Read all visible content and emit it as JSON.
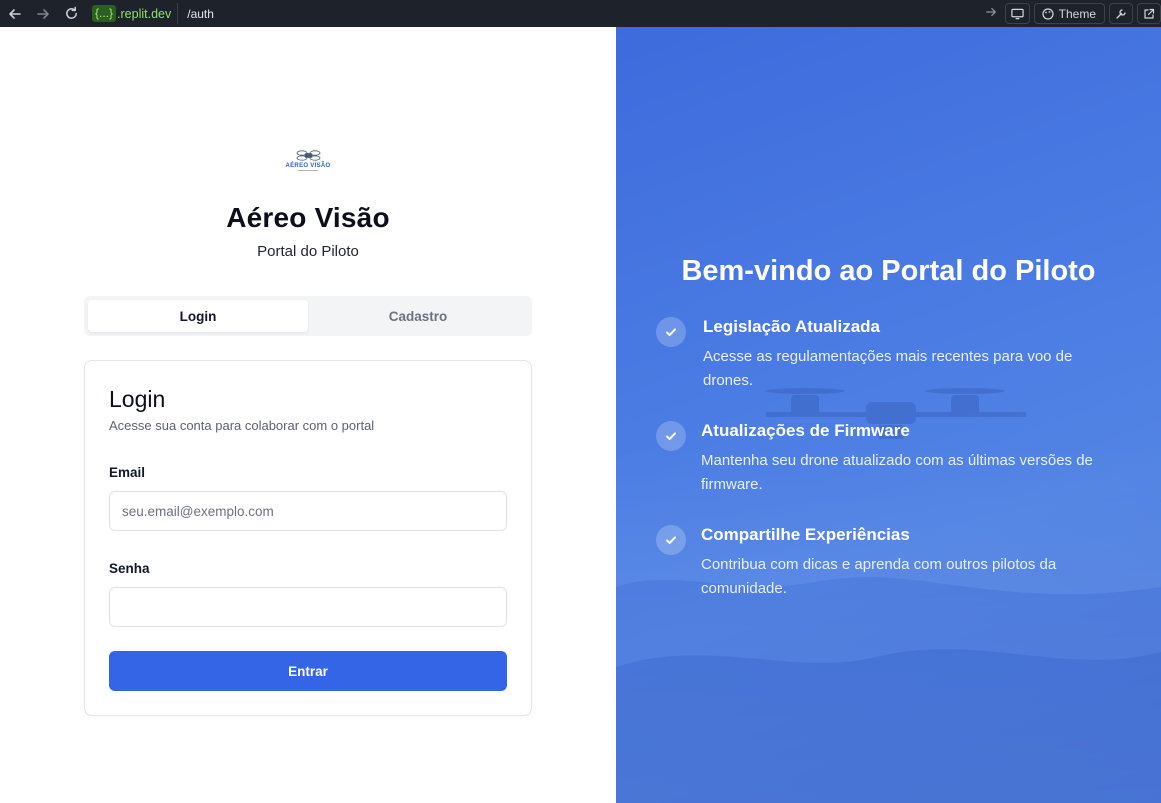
{
  "browser": {
    "url_chip": "{...}",
    "url_domain": ".replit.dev",
    "url_path": "/auth",
    "theme_label": "Theme"
  },
  "brand": {
    "logo_text": "AÉREO VISÃO",
    "title": "Aéreo Visão",
    "subtitle": "Portal do Piloto"
  },
  "tabs": [
    {
      "label": "Login",
      "active": true
    },
    {
      "label": "Cadastro",
      "active": false
    }
  ],
  "login_card": {
    "title": "Login",
    "description": "Acesse sua conta para colaborar com o portal",
    "email_label": "Email",
    "email_placeholder": "seu.email@exemplo.com",
    "email_value": "",
    "password_label": "Senha",
    "password_value": "",
    "submit_label": "Entrar"
  },
  "hero": {
    "title": "Bem-vindo ao Portal do Piloto",
    "features": [
      {
        "title": "Legislação Atualizada",
        "description": "Acesse as regulamentações mais recentes para voo de drones."
      },
      {
        "title": "Atualizações de Firmware",
        "description": "Mantenha seu drone atualizado com as últimas versões de firmware."
      },
      {
        "title": "Compartilhe Experiências",
        "description": "Contribua com dicas e aprenda com outros pilotos da comunidade."
      }
    ]
  },
  "colors": {
    "primary_button": "#3465e6",
    "hero_background": "#4a7be3",
    "browser_bar": "#1e222b"
  },
  "icons": {
    "back": "arrow-left-icon",
    "forward": "arrow-right-icon",
    "reload": "reload-icon",
    "go": "arrow-right-icon",
    "devices": "monitor-icon",
    "theme": "palette-icon",
    "tools": "wrench-icon",
    "open_external": "external-link-icon",
    "feature_check": "check-icon"
  }
}
